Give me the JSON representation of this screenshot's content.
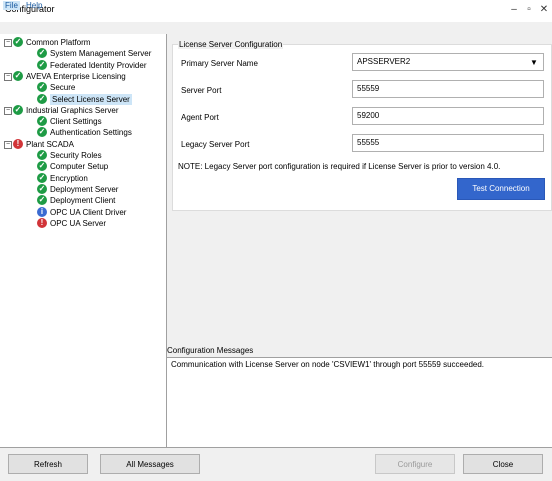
{
  "window": {
    "title": "Configurator"
  },
  "menu": {
    "file": "File",
    "help": "Help"
  },
  "tree": [
    {
      "label": "Common Platform",
      "status": "ok",
      "level": 0,
      "expander": "⊟"
    },
    {
      "label": "System Management Server",
      "status": "ok",
      "level": 1
    },
    {
      "label": "Federated Identity Provider",
      "status": "ok",
      "level": 1
    },
    {
      "label": "AVEVA Enterprise Licensing",
      "status": "ok",
      "level": 0,
      "expander": "⊟"
    },
    {
      "label": "Secure",
      "status": "ok",
      "level": 1
    },
    {
      "label": "Select License Server",
      "status": "ok",
      "level": 1,
      "selected": true
    },
    {
      "label": "Industrial Graphics Server",
      "status": "ok",
      "level": 0,
      "expander": "⊟"
    },
    {
      "label": "Client Settings",
      "status": "ok",
      "level": 1
    },
    {
      "label": "Authentication Settings",
      "status": "ok",
      "level": 1
    },
    {
      "label": "Plant SCADA",
      "status": "error",
      "level": 0,
      "expander": "⊟"
    },
    {
      "label": "Security Roles",
      "status": "ok",
      "level": 1
    },
    {
      "label": "Computer Setup",
      "status": "ok",
      "level": 1
    },
    {
      "label": "Encryption",
      "status": "ok",
      "level": 1
    },
    {
      "label": "Deployment Server",
      "status": "ok",
      "level": 1
    },
    {
      "label": "Deployment Client",
      "status": "ok",
      "level": 1
    },
    {
      "label": "OPC UA Client Driver",
      "status": "info",
      "level": 1
    },
    {
      "label": "OPC UA Server",
      "status": "error",
      "level": 1
    }
  ],
  "license_config": {
    "group_title": "License Server Configuration",
    "primary_server_label": "Primary Server Name",
    "primary_server_value": "APSSERVER2",
    "server_port_label": "Server Port",
    "server_port_value": "55559",
    "agent_port_label": "Agent Port",
    "agent_port_value": "59200",
    "legacy_port_label": "Legacy Server Port",
    "legacy_port_value": "55555",
    "note": "NOTE: Legacy Server port configuration is required if License Server is prior to version 4.0.",
    "test_button": "Test Connection"
  },
  "messages": {
    "label": "Configuration Messages",
    "text": "Communication with License Server on node 'CSVIEW1' through port 55559 succeeded."
  },
  "buttons": {
    "refresh": "Refresh",
    "all_messages": "All Messages",
    "configure": "Configure",
    "close": "Close"
  },
  "colors": {
    "ok": "#1e9b45",
    "error": "#d13438",
    "info": "#3b6bd1",
    "accent": "#3366cc"
  }
}
